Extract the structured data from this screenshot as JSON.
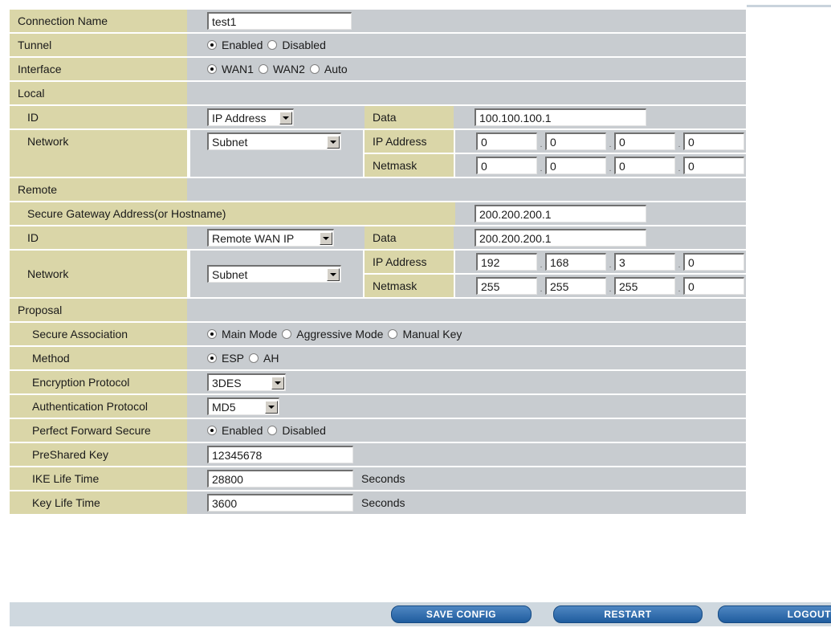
{
  "connection_name": {
    "label": "Connection Name",
    "value": "test1"
  },
  "tunnel": {
    "label": "Tunnel",
    "options": [
      "Enabled",
      "Disabled"
    ],
    "selected": "Enabled"
  },
  "interface": {
    "label": "Interface",
    "options": [
      "WAN1",
      "WAN2",
      "Auto"
    ],
    "selected": "WAN1"
  },
  "local": {
    "section_label": "Local",
    "id_label": "ID",
    "id_type": "IP Address",
    "data_label": "Data",
    "data_value": "100.100.100.1",
    "network_label": "Network",
    "network_type": "Subnet",
    "ip_label": "IP Address",
    "ip": [
      "0",
      "0",
      "0",
      "0"
    ],
    "netmask_label": "Netmask",
    "netmask": [
      "0",
      "0",
      "0",
      "0"
    ]
  },
  "remote": {
    "section_label": "Remote",
    "gateway_label": "Secure Gateway Address(or Hostname)",
    "gateway_value": "200.200.200.1",
    "id_label": "ID",
    "id_type": "Remote WAN IP",
    "data_label": "Data",
    "data_value": "200.200.200.1",
    "network_label": "Network",
    "network_type": "Subnet",
    "ip_label": "IP Address",
    "ip": [
      "192",
      "168",
      "3",
      "0"
    ],
    "netmask_label": "Netmask",
    "netmask": [
      "255",
      "255",
      "255",
      "0"
    ]
  },
  "proposal": {
    "section_label": "Proposal",
    "sa_label": "Secure Association",
    "sa_options": [
      "Main Mode",
      "Aggressive Mode",
      "Manual Key"
    ],
    "sa_selected": "Main Mode",
    "method_label": "Method",
    "method_options": [
      "ESP",
      "AH"
    ],
    "method_selected": "ESP",
    "enc_label": "Encryption Protocol",
    "enc_value": "3DES",
    "auth_label": "Authentication Protocol",
    "auth_value": "MD5",
    "pfs_label": "Perfect Forward Secure",
    "pfs_options": [
      "Enabled",
      "Disabled"
    ],
    "pfs_selected": "Enabled",
    "psk_label": "PreShared Key",
    "psk_value": "12345678",
    "ike_label": "IKE Life Time",
    "ike_value": "28800",
    "key_label": "Key Life Time",
    "key_value": "3600",
    "seconds_label": "Seconds"
  },
  "buttons": {
    "save": "SAVE CONFIG",
    "restart": "RESTART",
    "logout": "LOGOUT"
  }
}
